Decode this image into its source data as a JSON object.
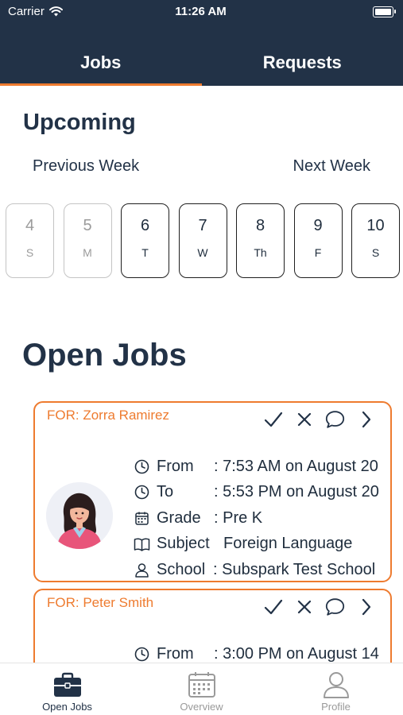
{
  "status_bar": {
    "carrier": "Carrier",
    "time": "11:26 AM"
  },
  "tabs": [
    {
      "label": "Jobs",
      "active": true
    },
    {
      "label": "Requests",
      "active": false
    }
  ],
  "upcoming": {
    "title": "Upcoming",
    "previous_week": "Previous Week",
    "next_week": "Next Week",
    "days": [
      {
        "num": "4",
        "dow": "S",
        "past": true
      },
      {
        "num": "5",
        "dow": "M",
        "past": true
      },
      {
        "num": "6",
        "dow": "T",
        "past": false
      },
      {
        "num": "7",
        "dow": "W",
        "past": false
      },
      {
        "num": "8",
        "dow": "Th",
        "past": false
      },
      {
        "num": "9",
        "dow": "F",
        "past": false
      },
      {
        "num": "10",
        "dow": "S",
        "past": false
      }
    ]
  },
  "open_jobs": {
    "title": "Open Jobs",
    "jobs": [
      {
        "for": "FOR: Zorra Ramirez",
        "from_label": "From",
        "from_value": ": 7:53 AM on August 20",
        "to_label": "To",
        "to_value": ": 5:53 PM on August 20",
        "grade_label": "Grade",
        "grade_value": ": Pre K",
        "subject_label": "Subject",
        "subject_value": "Foreign Language",
        "school_label": "School",
        "school_value": ": Subspark Test School"
      },
      {
        "for": "FOR: Peter Smith",
        "from_label": "From",
        "from_value": ": 3:00 PM on August 14"
      }
    ]
  },
  "bottom_nav": [
    {
      "label": "Open Jobs",
      "icon": "briefcase-icon",
      "active": true
    },
    {
      "label": "Overview",
      "icon": "calendar-icon",
      "active": false
    },
    {
      "label": "Profile",
      "icon": "person-icon",
      "active": false
    }
  ],
  "colors": {
    "header": "#223247",
    "accent": "#ee7b2f"
  }
}
